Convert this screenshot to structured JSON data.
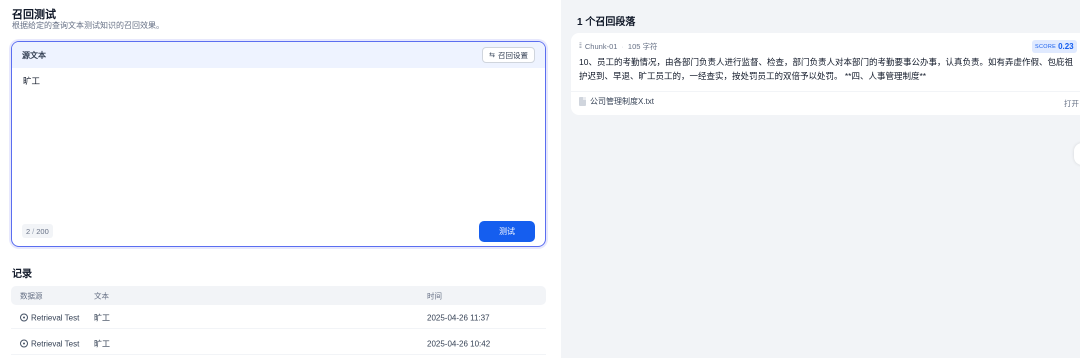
{
  "page": {
    "title": "召回测试",
    "subtitle": "根据给定的查询文本测试知识的召回效果。"
  },
  "query": {
    "header_label": "源文本",
    "settings_label": "召回设置",
    "settings_icon": "sliders-icon",
    "text": "旷工",
    "count_current": "2",
    "count_separator": "/",
    "count_max": "200",
    "test_button": "测试"
  },
  "records": {
    "title": "记录",
    "columns": [
      "数据源",
      "文本",
      "时间"
    ],
    "rows": [
      {
        "source": "Retrieval Test",
        "text": "旷工",
        "time": "2025-04-26 11:37"
      },
      {
        "source": "Retrieval Test",
        "text": "旷工",
        "time": "2025-04-26 10:42"
      }
    ]
  },
  "results": {
    "title": "1 个召回段落",
    "chunks": [
      {
        "chunk_id": "Chunk-01",
        "chars": "105 字符",
        "score_label": "SCORE",
        "score": "0.23",
        "content": "10、员工的考勤情况，由各部门负责人进行监督、检查，部门负责人对本部门的考勤要事公办事，认真负责。如有弄虚作假、包庇祖护迟到、早退、旷工员工的，一经查实，按处罚员工的双倍予以处罚。 **四、人事管理制度**",
        "file_name": "公司管理制度X.txt",
        "open_label": "打开 ↗"
      }
    ]
  },
  "colors": {
    "accent": "#155eef",
    "border_active": "#5b6ef0",
    "panel_bg": "#f2f4f7"
  }
}
